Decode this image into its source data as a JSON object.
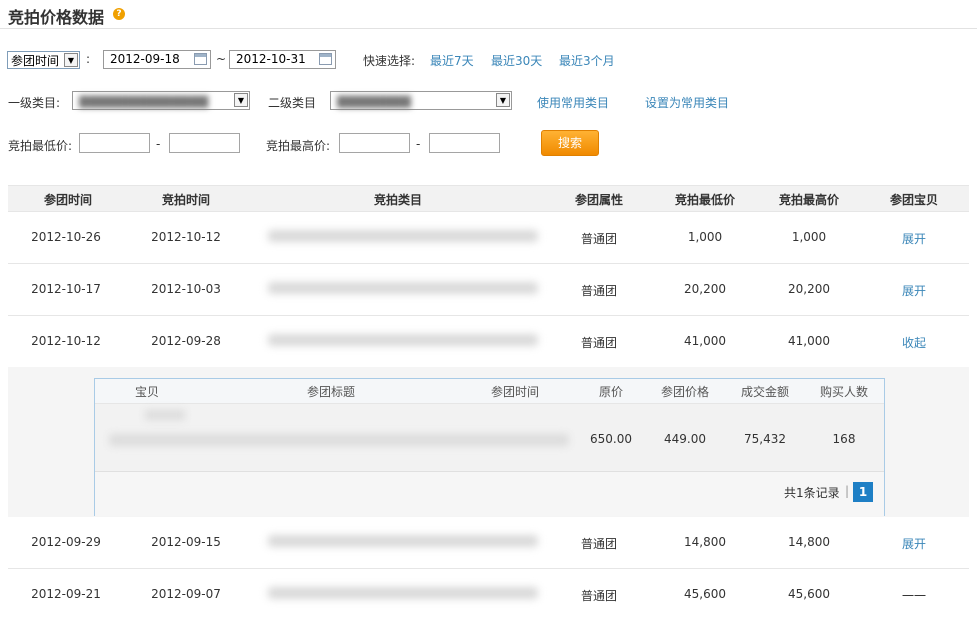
{
  "page": {
    "title": "竞拍价格数据",
    "help_icon": "?"
  },
  "filters": {
    "time_type": "参团时间",
    "colon": ":",
    "date_from": "2012-09-18",
    "tilde": "~",
    "date_to": "2012-10-31",
    "quick_label": "快速选择:",
    "quick_links": [
      "最近7天",
      "最近30天",
      "最近3个月"
    ],
    "cat1_label": "一级类目:",
    "cat2_label": "二级类目",
    "use_common": "使用常用类目",
    "set_common": "设置为常用类目",
    "min_label": "竞拍最低价:",
    "max_label": "竞拍最高价:",
    "dash": "-",
    "search": "搜索"
  },
  "table": {
    "headers": [
      "参团时间",
      "竞拍时间",
      "竞拍类目",
      "参团属性",
      "竞拍最低价",
      "竞拍最高价",
      "参团宝贝"
    ],
    "rows": [
      {
        "join": "2012-10-26",
        "bid": "2012-10-12",
        "attr": "普通团",
        "min": "1,000",
        "max": "1,000",
        "action": "展开"
      },
      {
        "join": "2012-10-17",
        "bid": "2012-10-03",
        "attr": "普通团",
        "min": "20,200",
        "max": "20,200",
        "action": "展开"
      },
      {
        "join": "2012-10-12",
        "bid": "2012-09-28",
        "attr": "普通团",
        "min": "41,000",
        "max": "41,000",
        "action": "收起"
      },
      {
        "join": "2012-09-29",
        "bid": "2012-09-15",
        "attr": "普通团",
        "min": "14,800",
        "max": "14,800",
        "action": "展开"
      },
      {
        "join": "2012-09-21",
        "bid": "2012-09-07",
        "attr": "普通团",
        "min": "45,600",
        "max": "45,600",
        "action": "一一"
      }
    ]
  },
  "subtable": {
    "headers": [
      "宝贝",
      "参团标题",
      "参团时间",
      "原价",
      "参团价格",
      "成交金额",
      "购买人数"
    ],
    "row": {
      "original": "650.00",
      "group_price": "449.00",
      "amount": "75,432",
      "buyers": "168"
    },
    "total": "共1条记录",
    "page": "1"
  }
}
